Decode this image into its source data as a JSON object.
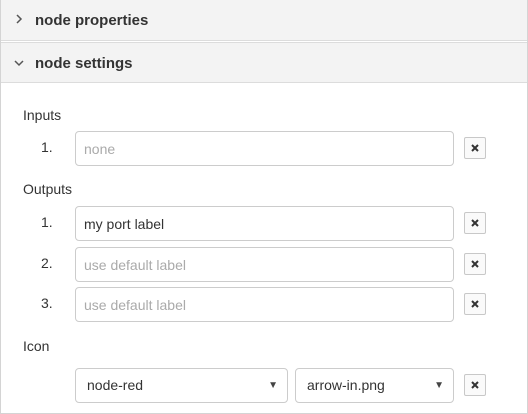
{
  "sections": {
    "properties": {
      "title": "node properties",
      "expanded": false
    },
    "settings": {
      "title": "node settings",
      "expanded": true
    }
  },
  "inputs": {
    "label": "Inputs",
    "rows": [
      {
        "number": "1.",
        "value": "",
        "placeholder": "none"
      }
    ]
  },
  "outputs": {
    "label": "Outputs",
    "rows": [
      {
        "number": "1.",
        "value": "my port label",
        "placeholder": ""
      },
      {
        "number": "2.",
        "value": "",
        "placeholder": "use default label"
      },
      {
        "number": "3.",
        "value": "",
        "placeholder": "use default label"
      }
    ]
  },
  "icon": {
    "label": "Icon",
    "module_select": "node-red",
    "file_select": "arrow-in.png"
  },
  "icons": {
    "collapsed": "chevron-right-icon",
    "expanded": "chevron-down-icon",
    "delete": "close-icon",
    "dropdown": "caret-down-icon"
  }
}
